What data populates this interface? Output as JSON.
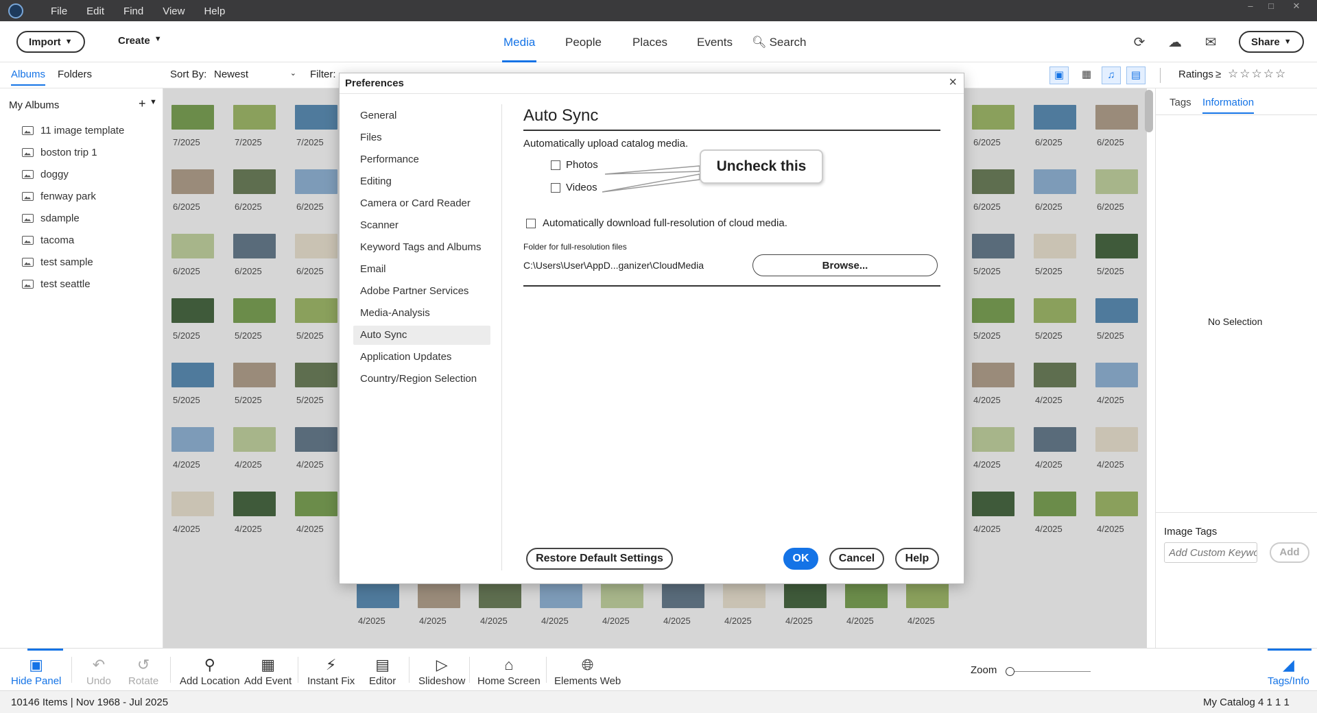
{
  "menu": [
    "File",
    "Edit",
    "Find",
    "View",
    "Help"
  ],
  "topnav": {
    "import": "Import",
    "create": "Create",
    "tabs": [
      "Media",
      "People",
      "Places",
      "Events"
    ],
    "search": "Search",
    "share": "Share"
  },
  "subbar": {
    "albums_tab": "Albums",
    "folders_tab": "Folders",
    "sort_label": "Sort By:",
    "sort_value": "Newest",
    "filter_label": "Filter:",
    "ratings_label": "Ratings",
    "ratings_op": "≥",
    "stars": "☆☆☆☆☆"
  },
  "leftpanel": {
    "header": "My Albums",
    "add": "+",
    "albums": [
      "11 image template",
      "boston trip 1",
      "doggy",
      "fenway park",
      "sdample",
      "tacoma",
      "test sample",
      "test seattle"
    ]
  },
  "grid": {
    "left_dates": [
      [
        "7/2025",
        "7/2025",
        "7/2025"
      ],
      [
        "6/2025",
        "6/2025",
        "6/2025"
      ],
      [
        "6/2025",
        "6/2025",
        "6/2025"
      ],
      [
        "5/2025",
        "5/2025",
        "5/2025"
      ],
      [
        "5/2025",
        "5/2025",
        "5/2025"
      ],
      [
        "4/2025",
        "4/2025",
        "4/2025"
      ],
      [
        "4/2025",
        "4/2025",
        "4/2025"
      ]
    ],
    "right_dates": [
      [
        "6/2025",
        "6/2025",
        "6/2025"
      ],
      [
        "6/2025",
        "6/2025",
        "6/2025"
      ],
      [
        "5/2025",
        "5/2025",
        "5/2025"
      ],
      [
        "5/2025",
        "5/2025",
        "5/2025"
      ],
      [
        "4/2025",
        "4/2025",
        "4/2025"
      ],
      [
        "4/2025",
        "4/2025",
        "4/2025"
      ],
      [
        "4/2025",
        "4/2025",
        "4/2025"
      ]
    ],
    "bottom_dates": [
      "4/2025",
      "4/2025",
      "4/2025",
      "4/2025",
      "4/2025",
      "4/2025",
      "4/2025",
      "4/2025",
      "4/2025",
      "4/2025"
    ]
  },
  "rightpanel": {
    "tags_tab": "Tags",
    "info_tab": "Information",
    "no_selection": "No Selection",
    "image_tags": "Image Tags",
    "keyword_placeholder": "Add Custom Keywo",
    "add": "Add"
  },
  "dialog": {
    "title": "Preferences",
    "close": "×",
    "categories": [
      "General",
      "Files",
      "Performance",
      "Editing",
      "Camera or Card Reader",
      "Scanner",
      "Keyword Tags and Albums",
      "Email",
      "Adobe Partner Services",
      "Media-Analysis",
      "Auto Sync",
      "Application Updates",
      "Country/Region Selection"
    ],
    "selected_category": "Auto Sync",
    "heading": "Auto Sync",
    "upload_text": "Automatically upload catalog media.",
    "photos": "Photos",
    "videos": "Videos",
    "download_text": "Automatically download full-resolution of cloud media.",
    "folder_label": "Folder for full-resolution files",
    "folder_path": "C:\\Users\\User\\AppD...ganizer\\CloudMedia",
    "browse": "Browse...",
    "restore": "Restore Default Settings",
    "ok": "OK",
    "cancel": "Cancel",
    "help": "Help",
    "callout": "Uncheck this"
  },
  "bottombar": {
    "tools": [
      "Hide Panel",
      "Undo",
      "Rotate",
      "Add Location",
      "Add Event",
      "Instant Fix",
      "Editor",
      "Slideshow",
      "Home Screen",
      "Elements Web"
    ],
    "zoom": "Zoom",
    "tags_info": "Tags/Info"
  },
  "status": {
    "items": "10146 Items | Nov 1968 - Jul 2025",
    "catalog": "My Catalog 4 1 1 1"
  },
  "colors": {
    "accent": "#1473e6",
    "titlebar": "#3a3a3c"
  }
}
